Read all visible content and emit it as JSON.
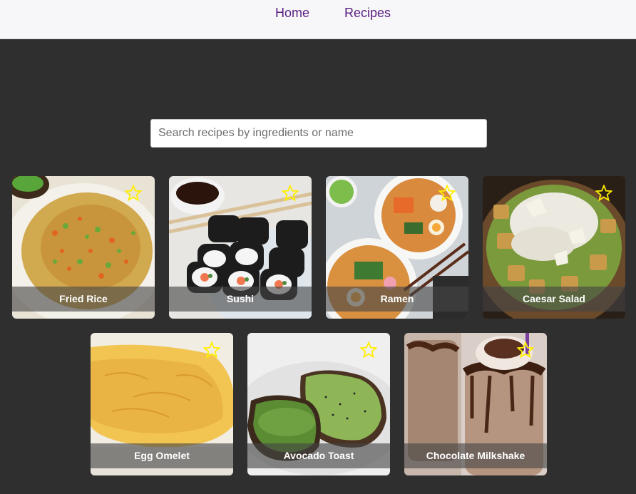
{
  "nav": {
    "home_label": "Home",
    "recipes_label": "Recipes"
  },
  "search": {
    "placeholder": "Search recipes by ingredients or name",
    "value": ""
  },
  "colors": {
    "background": "#2f2f2f",
    "nav_background": "#f7f7f9",
    "nav_link": "#5b1f82",
    "star": "#ffee00"
  },
  "recipes": [
    {
      "title": "Fried Rice",
      "favorite_icon": "star-outline-icon"
    },
    {
      "title": "Sushi",
      "favorite_icon": "star-outline-icon"
    },
    {
      "title": "Ramen",
      "favorite_icon": "star-outline-icon"
    },
    {
      "title": "Caesar Salad",
      "favorite_icon": "star-outline-icon"
    },
    {
      "title": "Egg Omelet",
      "favorite_icon": "star-outline-icon"
    },
    {
      "title": "Avocado Toast",
      "favorite_icon": "star-outline-icon"
    },
    {
      "title": "Chocolate Milkshake",
      "favorite_icon": "star-outline-icon"
    }
  ]
}
